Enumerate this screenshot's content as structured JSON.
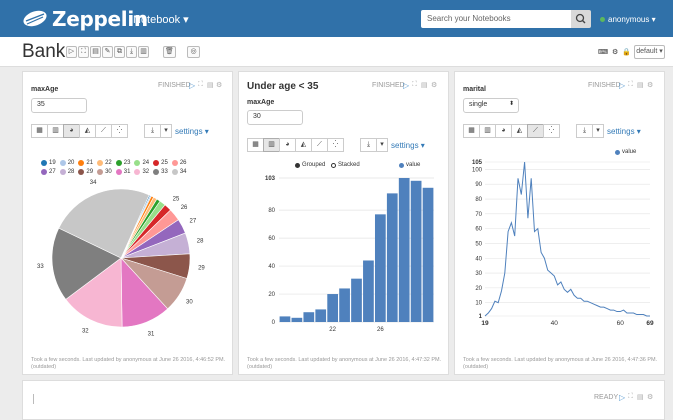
{
  "app": {
    "brand": "Zeppelin",
    "notebook_menu": "Notebook ▾",
    "search_placeholder": "Search your Notebooks",
    "user": "anonymous ▾"
  },
  "notebook": {
    "title": "Bank",
    "interpreter_default": "default ▾"
  },
  "paragraphs": [
    {
      "title": "maxAge",
      "status": "FINISHED",
      "input_value": "35",
      "settings_label": "settings ▾",
      "footer_line1": "Took a few seconds. Last updated by anonymous at June 26 2016, 4:46:52 PM.",
      "footer_line2": "(outdated)",
      "legend": [
        "19",
        "20",
        "21",
        "22",
        "23",
        "24",
        "25",
        "26",
        "27",
        "28",
        "29",
        "30",
        "31",
        "32",
        "33",
        "34"
      ]
    },
    {
      "title": "Under age < 35",
      "status": "FINISHED",
      "param_label": "maxAge",
      "input_value": "30",
      "settings_label": "settings ▾",
      "grouped": "Grouped",
      "stacked": "Stacked",
      "value_legend": "value",
      "footer_line1": "Took a few seconds. Last updated by anonymous at June 26 2016, 4:47:32 PM.",
      "footer_line2": "(outdated)"
    },
    {
      "title": "marital",
      "status": "FINISHED",
      "select_value": "single",
      "settings_label": "settings ▾",
      "value_legend": "value",
      "footer_line1": "Took a few seconds. Last updated by anonymous at June 26 2016, 4:47:36 PM.",
      "footer_line2": "(outdated)"
    },
    {
      "status": "READY"
    }
  ],
  "colors": {
    "nav": "#3071a9",
    "bar": "#4f81bd"
  },
  "chart_data": [
    {
      "type": "pie",
      "title": "",
      "categories": [
        "19",
        "20",
        "21",
        "22",
        "23",
        "24",
        "25",
        "26",
        "27",
        "28",
        "29",
        "30",
        "31",
        "32",
        "33",
        "34"
      ],
      "values": [
        1,
        1,
        2,
        3,
        3,
        5,
        6,
        10,
        12,
        17,
        20,
        29,
        40,
        52,
        60,
        85
      ],
      "slice_labels_shown": [
        "25",
        "26",
        "27",
        "28",
        "29",
        "30",
        "31",
        "32",
        "33",
        "34"
      ],
      "legend": "top"
    },
    {
      "type": "bar",
      "title": "",
      "categories": [
        "18",
        "19",
        "20",
        "21",
        "22",
        "23",
        "24",
        "25",
        "26",
        "27",
        "28",
        "29",
        "30"
      ],
      "values": [
        4,
        3,
        7,
        9,
        20,
        24,
        31,
        44,
        77,
        92,
        103,
        101,
        96
      ],
      "x_tick_labels": [
        "22",
        "26"
      ],
      "ylim": [
        0,
        103
      ],
      "y_ticks": [
        0,
        20,
        40,
        60,
        80,
        103
      ],
      "legend": "top-right"
    },
    {
      "type": "line",
      "title": "",
      "x": [
        19,
        20,
        21,
        22,
        23,
        24,
        25,
        26,
        27,
        28,
        29,
        30,
        31,
        32,
        33,
        34,
        35,
        36,
        37,
        38,
        39,
        40,
        41,
        42,
        43,
        44,
        45,
        46,
        47,
        48,
        49,
        50,
        51,
        52,
        53,
        54,
        55,
        56,
        57,
        58,
        59,
        60,
        61,
        62,
        63,
        64,
        65,
        66,
        67,
        68,
        69
      ],
      "y": [
        1,
        3,
        6,
        11,
        10,
        18,
        30,
        58,
        64,
        55,
        94,
        83,
        105,
        67,
        94,
        58,
        60,
        44,
        40,
        32,
        30,
        28,
        22,
        24,
        19,
        17,
        19,
        15,
        13,
        13,
        11,
        11,
        10,
        9,
        8,
        7,
        7,
        6,
        5,
        5,
        4,
        4,
        5,
        3,
        3,
        3,
        2,
        2,
        2,
        1,
        1
      ],
      "xlim": [
        19,
        69
      ],
      "ylim": [
        1,
        105
      ],
      "x_ticks": [
        19,
        40,
        60,
        69
      ],
      "y_ticks": [
        1,
        10,
        20,
        30,
        40,
        50,
        60,
        70,
        80,
        90,
        100,
        105
      ],
      "legend": "top-right"
    }
  ]
}
